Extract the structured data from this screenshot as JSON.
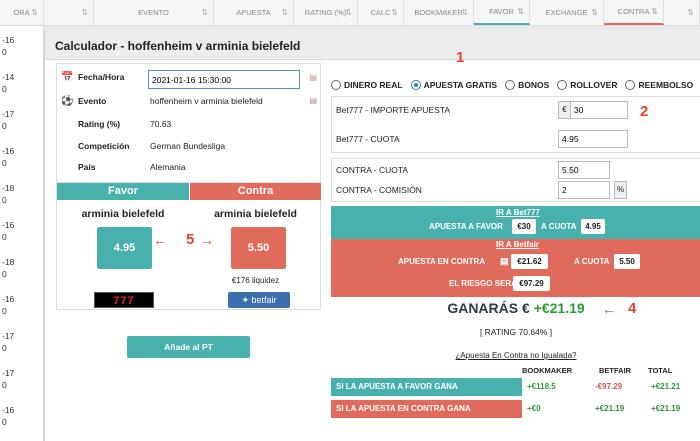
{
  "background": {
    "headers": [
      {
        "label": "ORA",
        "width": 44
      },
      {
        "label": "",
        "width": 50
      },
      {
        "label": "EVENTO",
        "width": 120
      },
      {
        "label": "APUESTA",
        "width": 80
      },
      {
        "label": "RATING (%)",
        "width": 64
      },
      {
        "label": "CALC",
        "width": 46
      },
      {
        "label": "BOOKMAKER",
        "width": 70
      },
      {
        "label": "FAVOR",
        "width": 56
      },
      {
        "label": "EXCHANGE",
        "width": 74
      },
      {
        "label": "CONTRA",
        "width": 60
      },
      {
        "label": "",
        "width": 36
      }
    ],
    "left_rows": [
      "-16",
      "0",
      "-14",
      "0",
      "-17",
      "0",
      "-16",
      "0",
      "-18",
      "0",
      "-16",
      "0",
      "-18",
      "0",
      "-16",
      "0",
      "-17",
      "0",
      "-17",
      "0",
      "-16",
      "0"
    ]
  },
  "modal": {
    "title": "Calculador - hoffenheim v arminia bielefeld",
    "info": {
      "fecha_label": "Fecha/Hora",
      "fecha_value": "2021-01-16 15:30:00",
      "evento_label": "Evento",
      "evento_value": "hoffenheim v arminia bielefeld",
      "rating_label": "Rating (%)",
      "rating_value": "70.63",
      "competicion_label": "Competición",
      "competicion_value": "German Bundesliga",
      "pais_label": "País",
      "pais_value": "Alemania"
    },
    "favor_contra": {
      "favor_head": "Favor",
      "contra_head": "Contra",
      "favor_team": "arminia bielefeld",
      "contra_team": "arminia bielefeld",
      "favor_odds": "4.95",
      "contra_odds": "5.50",
      "contra_liquidity": "€176 liquidez",
      "logo_777": "777",
      "logo_betfair": "betfair"
    },
    "add_button": "Añade al PT",
    "radios": [
      {
        "label": "DINERO REAL",
        "selected": false
      },
      {
        "label": "APUESTA GRATIS",
        "selected": true
      },
      {
        "label": "BONOS",
        "selected": false
      },
      {
        "label": "ROLLOVER",
        "selected": false
      },
      {
        "label": "REEMBOLSO",
        "selected": false
      }
    ],
    "fields": {
      "importe_label": "Bet777 - IMPORTE APUESTA",
      "currency": "€",
      "importe_value": "30",
      "cuota_label": "Bet777 - CUOTA",
      "cuota_value": "4.95",
      "contra_cuota_label": "CONTRA - CUOTA",
      "contra_cuota_value": "5.50",
      "comision_label": "CONTRA - COMISIÓN",
      "comision_value": "2",
      "percent": "%"
    },
    "bet_instructions": {
      "ir_bet777": "IR A Bet777",
      "apuesta_favor": "APUESTA A FAVOR",
      "favor_amount": "€30",
      "a_cuota": "A CUOTA",
      "favor_cuota": "4.95",
      "ir_betfair": "IR A Betfair",
      "apuesta_contra": "APUESTA EN CONTRA",
      "contra_amount": "€21.62",
      "contra_cuota": "5.50",
      "riesgo_label": "EL RIESGO SERÁ",
      "riesgo_amount": "€97.29"
    },
    "result": {
      "ganaras_label": "GANARÁS €",
      "ganaras_amount": "+€21.19",
      "rating_line": "[ RATING 70.64% ]"
    },
    "summary": {
      "link": "¿Apuesta En Contra no Igualada?",
      "col_bookmaker": "BOOKMAKER",
      "col_betfair": "BETFAIR",
      "col_total": "TOTAL",
      "row1_label": "SI LA APUESTA A FAVOR GANA",
      "row1_bookmaker": "+€118.5",
      "row1_betfair": "-€97.29",
      "row1_total": "+€21.21",
      "row2_label": "SI LA APUESTA EN CONTRA GANA",
      "row2_bookmaker": "+€0",
      "row2_betfair": "+€21.19",
      "row2_total": "+€21.19"
    },
    "annotations": {
      "n1": "1",
      "n2": "2",
      "n4": "4",
      "n5": "5"
    }
  },
  "colors": {
    "favor": "#49b1ad",
    "contra": "#e06b5c",
    "annotation": "#e04433",
    "profit": "#2e9a3a"
  }
}
